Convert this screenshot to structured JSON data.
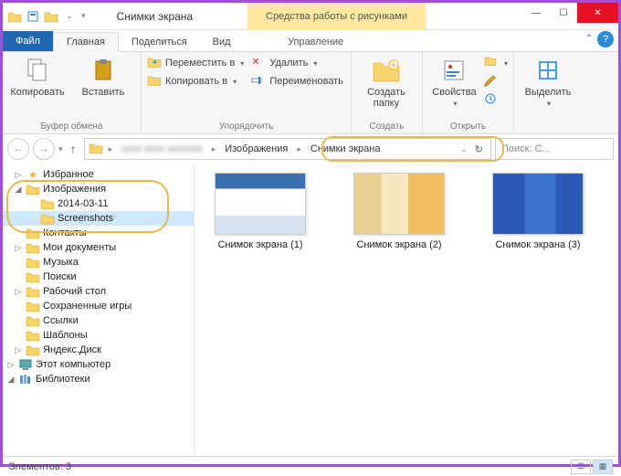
{
  "window": {
    "title": "Снимки экрана",
    "contextual_tab": "Средства работы с рисунками"
  },
  "tabs": {
    "file": "Файл",
    "home": "Главная",
    "share": "Поделиться",
    "view": "Вид",
    "manage": "Управление"
  },
  "ribbon": {
    "clipboard": {
      "label": "Буфер обмена",
      "copy": "Копировать",
      "paste": "Вставить"
    },
    "organize": {
      "label": "Упорядочить",
      "move_to": "Переместить в",
      "copy_to": "Копировать в",
      "delete": "Удалить",
      "rename": "Переименовать"
    },
    "new": {
      "label": "Создать",
      "new_folder": "Создать\nпапку"
    },
    "open": {
      "label": "Открыть",
      "properties": "Свойства"
    },
    "select": {
      "label": "",
      "select_btn": "Выделить"
    }
  },
  "breadcrumb": {
    "hidden": "xxxx xxxx xxxxxxx",
    "items": [
      "Изображения",
      "Снимки экрана"
    ]
  },
  "search": {
    "placeholder": "Поиск: С..."
  },
  "tree": {
    "items": [
      {
        "label": "Избранное",
        "level": 1,
        "twisty": "▷",
        "icon": "star"
      },
      {
        "label": "Изображения",
        "level": 1,
        "twisty": "◢",
        "icon": "folder",
        "hl": true
      },
      {
        "label": "2014-03-11",
        "level": 2,
        "twisty": "",
        "icon": "folder",
        "hl": true
      },
      {
        "label": "Screenshots",
        "level": 2,
        "twisty": "",
        "icon": "folder",
        "hl": true,
        "selected": true
      },
      {
        "label": "Контакты",
        "level": 1,
        "twisty": "",
        "icon": "folder"
      },
      {
        "label": "Мои документы",
        "level": 1,
        "twisty": "▷",
        "icon": "folder"
      },
      {
        "label": "Музыка",
        "level": 1,
        "twisty": "",
        "icon": "folder"
      },
      {
        "label": "Поиски",
        "level": 1,
        "twisty": "",
        "icon": "folder"
      },
      {
        "label": "Рабочий стол",
        "level": 1,
        "twisty": "▷",
        "icon": "folder"
      },
      {
        "label": "Сохраненные игры",
        "level": 1,
        "twisty": "",
        "icon": "folder"
      },
      {
        "label": "Ссылки",
        "level": 1,
        "twisty": "",
        "icon": "folder"
      },
      {
        "label": "Шаблоны",
        "level": 1,
        "twisty": "",
        "icon": "folder"
      },
      {
        "label": "Яндекс.Диск",
        "level": 1,
        "twisty": "▷",
        "icon": "folder"
      },
      {
        "label": "Этот компьютер",
        "level": 0,
        "twisty": "▷",
        "icon": "pc"
      },
      {
        "label": "Библиотеки",
        "level": 0,
        "twisty": "◢",
        "icon": "lib"
      }
    ]
  },
  "files": [
    {
      "name": "Снимок экрана (1)",
      "thumb": "a"
    },
    {
      "name": "Снимок экрана (2)",
      "thumb": "b"
    },
    {
      "name": "Снимок экрана (3)",
      "thumb": "c"
    }
  ],
  "status": {
    "text": "Элементов: 3"
  }
}
